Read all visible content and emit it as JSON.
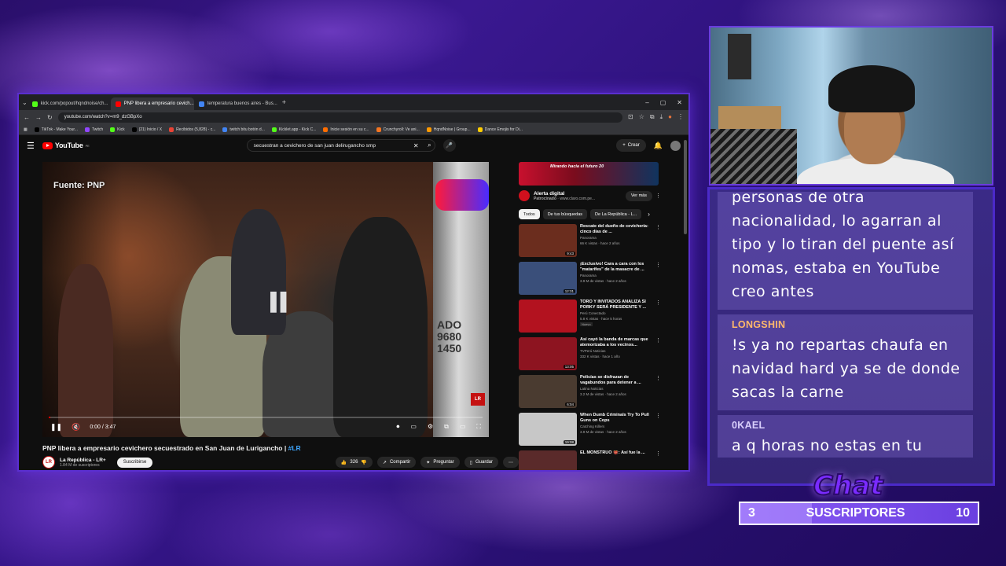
{
  "browser": {
    "tabs": [
      {
        "label": "kick.com/popout/hqndnoise/ch...",
        "color": "#53fc18"
      },
      {
        "label": "PNP libera a empresario cevich...",
        "color": "#ff0000"
      },
      {
        "label": "temperatura buenos aires - Bus...",
        "color": "#4285f4"
      }
    ],
    "url": "youtube.com/watch?v=m9_dzGBpXo",
    "bookmarks": [
      {
        "label": "TikTok - Make Your...",
        "color": "#000000"
      },
      {
        "label": "Twitch",
        "color": "#9146ff"
      },
      {
        "label": "Kick",
        "color": "#53fc18"
      },
      {
        "label": "(21) Inicio / X",
        "color": "#000000"
      },
      {
        "label": "Recibidos (5,828) - c...",
        "color": "#ea4335"
      },
      {
        "label": "twitch bitu botón d...",
        "color": "#4285f4"
      },
      {
        "label": "Kicklet.app - Kick C...",
        "color": "#53fc18"
      },
      {
        "label": "Inicie sesión en su c...",
        "color": "#ff6d00"
      },
      {
        "label": "Crunchyroll: Ve ani...",
        "color": "#f47521"
      },
      {
        "label": "HqndNoise | Group...",
        "color": "#ff9900"
      },
      {
        "label": "Dance Emojis for Di...",
        "color": "#ffcc00"
      }
    ]
  },
  "youtube": {
    "logo_text": "YouTube",
    "logo_country": "PE",
    "search_query": "secuestran a cevichero de san juan delirugancho smp",
    "create_label": "Crear",
    "player": {
      "source_text": "Fuente: PNP",
      "watermark": "LR",
      "time": "0:00 / 3:47",
      "progress": 0.0
    },
    "video_title": "PNP libera a empresario cevichero secuestrado en San Juan de Lurigancho | ",
    "video_hashtag": "#LR",
    "channel_name": "La República - LR+",
    "channel_subs": "1.84 M de suscriptores",
    "subscribe_label": "Suscribirse",
    "likes": "326",
    "share_label": "Compartir",
    "ask_label": "Preguntar",
    "save_label": "Guardar"
  },
  "sidebar": {
    "ad_banner_text": "Mirando hacia el futuro 20",
    "ad_title": "Alerta digital",
    "ad_sponsor": "Patrocinado",
    "ad_domain": "www.claro.com.pe...",
    "ad_button": "Ver más",
    "chips": [
      "Todos",
      "De tus búsquedas",
      "De La República - L..."
    ],
    "recommendations": [
      {
        "title": "Rescate del dueño de cevichería: cinco días de ...",
        "channel": "Panorama",
        "meta": "66 K vistas · hace 2 años",
        "duration": "9:43",
        "thumb": "#6b2d1e",
        "badge": ""
      },
      {
        "title": "¡Exclusivo! Cara a cara con los \"matarifes\" de la masacre de ...",
        "channel": "Panorama",
        "meta": "3.9 M de vistas · hace 2 años",
        "duration": "12:31",
        "thumb": "#3a4f7a",
        "badge": ""
      },
      {
        "title": "TORO Y INVITADOS ANALIZA SI PORKY SERÁ PRESIDENTE Y ...",
        "channel": "Perú Conectado",
        "meta": "5.8 K vistas · hace 5 horas",
        "duration": "",
        "thumb": "#b3121f",
        "badge": "Nuevo"
      },
      {
        "title": "Así cayó la banda de marcas que atemorizaba a los vecinos...",
        "channel": "TVPerú Noticias",
        "meta": "332 K vistas · hace 1 año",
        "duration": "13:05",
        "thumb": "#8d1420",
        "badge": ""
      },
      {
        "title": "Policías se disfrazan de vagabundos para detener a ...",
        "channel": "Latina Noticias",
        "meta": "3.2 M de vistas · hace 2 años",
        "duration": "6:04",
        "thumb": "#4a3b30",
        "badge": ""
      },
      {
        "title": "When Dumb Criminals Try To Pull Guns on Cops",
        "channel": "Catching Killers",
        "meta": "3.9 M de vistas · hace 2 años",
        "duration": "19:08",
        "thumb": "#c7c7c7",
        "badge": ""
      },
      {
        "title": "EL MONSTRUO 👹: Así fue la ...",
        "channel": "",
        "meta": "",
        "duration": "",
        "thumb": "#5a2a2a",
        "badge": ""
      }
    ]
  },
  "chat": {
    "messages": [
      {
        "user": "",
        "text": "personas de otra nacionalidad, lo agarran al tipo y lo tiran del puente así nomas, estaba en YouTube creo antes",
        "user_color": "#ffb86b"
      },
      {
        "user": "LONGSHIN",
        "text": "!s ya no repartas chaufa en navidad hard ya se de donde sacas la carne",
        "user_color": "#ffb86b"
      },
      {
        "user": "0KAEL",
        "text": "a q horas no estas en tu casa? es para una tarea",
        "user_color": "#d9cffc"
      }
    ],
    "logo_text": "Chat"
  },
  "subscriber_goal": {
    "current": "3",
    "label": "SUSCRIPTORES",
    "target": "10",
    "progress": 0.3
  }
}
